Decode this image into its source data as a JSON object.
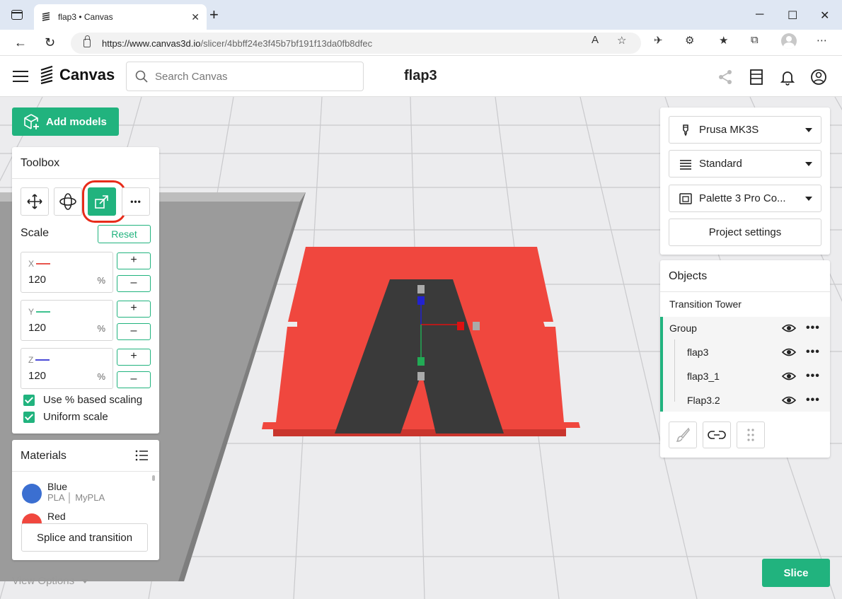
{
  "browser": {
    "tab_title": "flap3 • Canvas",
    "tab_close": "✕",
    "new_tab": "+",
    "url_domain": "https://www.canvas3d.io",
    "url_path": "/slicer/4bbff24e3f45b7bf191f13da0fb8dfec",
    "minimize": "─",
    "maximize": "☐",
    "close": "✕"
  },
  "app": {
    "brand": "Canvas",
    "search_placeholder": "Search Canvas",
    "document_title": "flap3"
  },
  "actions": {
    "add_models": "Add models",
    "slice": "Slice"
  },
  "toolbox": {
    "title": "Toolbox",
    "more": "•••",
    "scale_title": "Scale",
    "reset": "Reset",
    "axes": [
      {
        "label": "X",
        "value": "120",
        "unit": "%",
        "color": "#e8554d"
      },
      {
        "label": "Y",
        "value": "120",
        "unit": "%",
        "color": "#3ec28f"
      },
      {
        "label": "Z",
        "value": "120",
        "unit": "%",
        "color": "#4a4ad6"
      }
    ],
    "plus": "+",
    "minus": "–",
    "use_percent": "Use % based scaling",
    "uniform_scale": "Uniform scale"
  },
  "materials": {
    "title": "Materials",
    "items": [
      {
        "name": "Blue",
        "type": "PLA",
        "brand": "MyPLA",
        "color": "#3b6fd1"
      },
      {
        "name": "Red",
        "type": "",
        "brand": "",
        "color": "#f0473e"
      }
    ],
    "splice_button": "Splice and transition"
  },
  "view_options": "View Options",
  "settings": {
    "printer": "Prusa MK3S",
    "profile": "Standard",
    "palette": "Palette 3 Pro Co...",
    "project_settings": "Project settings"
  },
  "objects": {
    "title": "Objects",
    "transition_tower": "Transition Tower",
    "group": "Group",
    "children": [
      "flap3",
      "flap3_1",
      "Flap3.2"
    ],
    "dots": "•••"
  },
  "colors": {
    "accent": "#21b37e",
    "highlight_ring": "#e82b1a",
    "model_red": "#f0473e",
    "model_dark": "#3a3a3a"
  }
}
